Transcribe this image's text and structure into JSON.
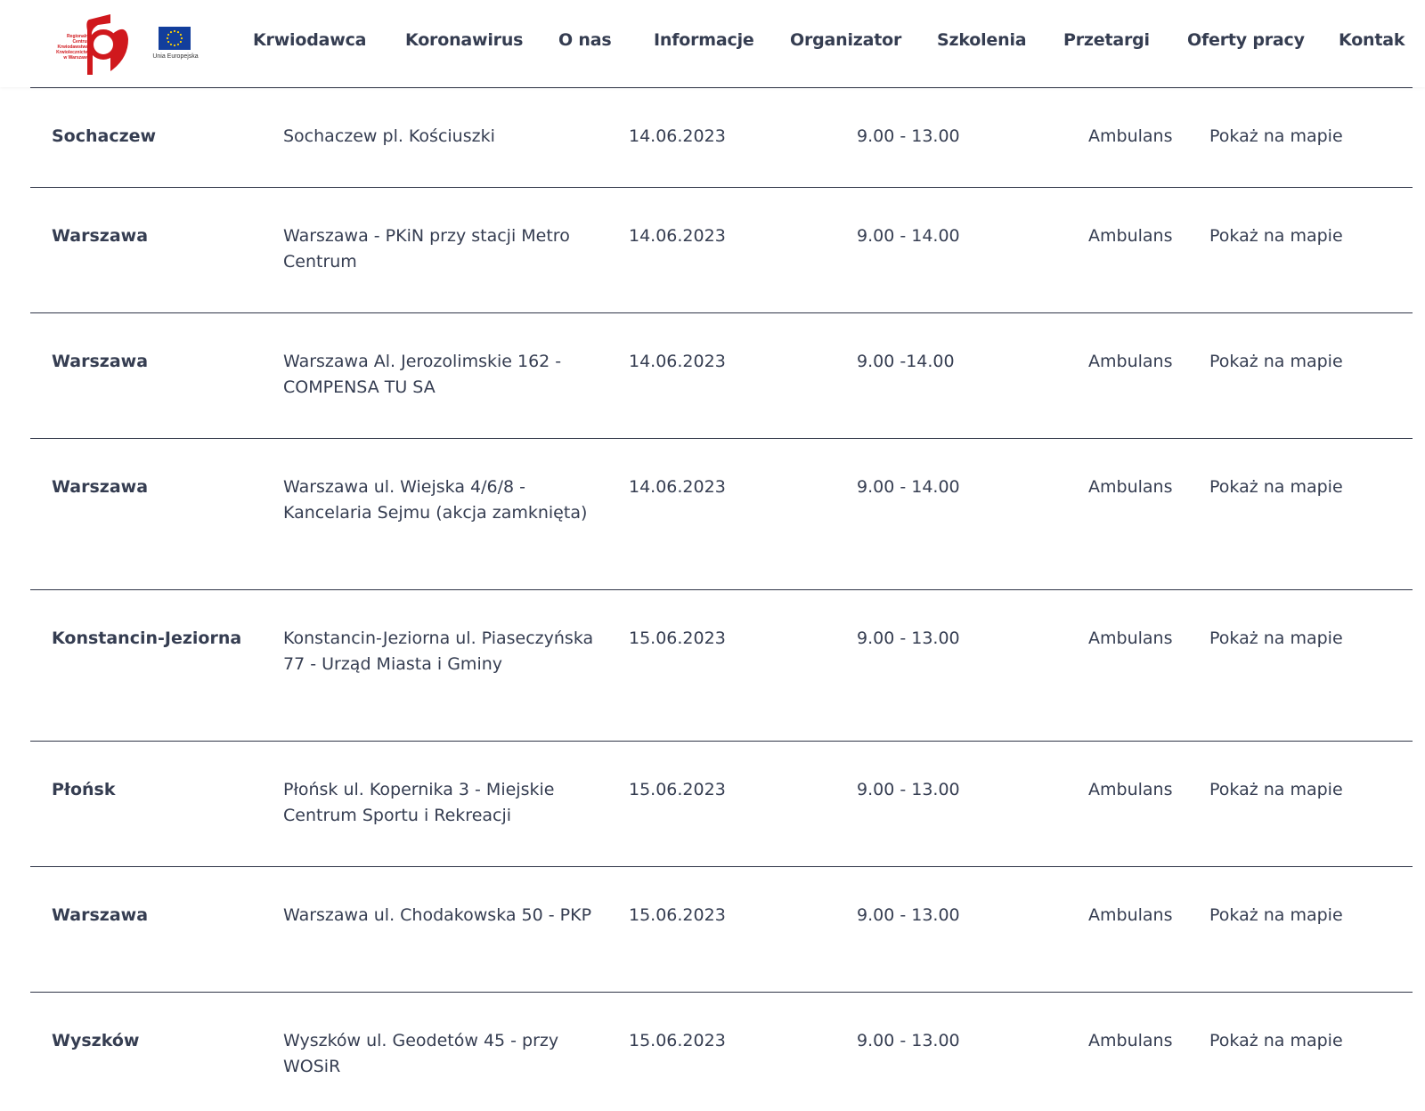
{
  "header": {
    "logo_text": "Regionalne Centrum Krwiodawstwa i Krwiolecznictwa w Warszawie",
    "eu_caption": "Unia Europejska",
    "colors": {
      "brand_red": "#d0181d",
      "eu_blue": "#123e9c",
      "eu_star": "#ffd200"
    }
  },
  "nav": {
    "items": [
      {
        "label": "Krwiodawca"
      },
      {
        "label": "Koronawirus"
      },
      {
        "label": "O nas"
      },
      {
        "label": "Informacje"
      },
      {
        "label": "Organizator"
      },
      {
        "label": "Szkolenia"
      },
      {
        "label": "Przetargi"
      },
      {
        "label": "Oferty pracy"
      },
      {
        "label": "Kontak"
      }
    ]
  },
  "rows": [
    {
      "city": "Sochaczew",
      "address": "Sochaczew pl. Kościuszki",
      "date": "14.06.2023",
      "time": "9.00 - 13.00",
      "type": "Ambulans",
      "map": "Pokaż na mapie"
    },
    {
      "city": "Warszawa",
      "address": "Warszawa - PKiN przy stacji Metro Centrum",
      "date": "14.06.2023",
      "time": "9.00 - 14.00",
      "type": "Ambulans",
      "map": "Pokaż na mapie"
    },
    {
      "city": "Warszawa",
      "address": "Warszawa Al. Jerozolimskie 162 - COMPENSA TU SA",
      "date": "14.06.2023",
      "time": "9.00 -14.00",
      "type": "Ambulans",
      "map": "Pokaż na mapie"
    },
    {
      "city": "Warszawa",
      "address": "Warszawa ul. Wiejska 4/6/8 - Kancelaria Sejmu (akcja zamknięta)",
      "date": "14.06.2023",
      "time": "9.00 - 14.00",
      "type": "Ambulans",
      "map": "Pokaż na mapie"
    },
    {
      "city": "Konstancin-Jeziorna",
      "address": "Konstancin-Jeziorna ul. Piaseczyńska 77 - Urząd Miasta i Gminy",
      "date": "15.06.2023",
      "time": "9.00 - 13.00",
      "type": "Ambulans",
      "map": "Pokaż na mapie"
    },
    {
      "city": "Płońsk",
      "address": "Płońsk ul. Kopernika 3 - Miejskie Centrum Sportu i Rekreacji",
      "date": "15.06.2023",
      "time": "9.00 - 13.00",
      "type": "Ambulans",
      "map": "Pokaż na mapie"
    },
    {
      "city": "Warszawa",
      "address": "Warszawa ul. Chodakowska 50 - PKP",
      "date": "15.06.2023",
      "time": "9.00 - 13.00",
      "type": "Ambulans",
      "map": "Pokaż na mapie"
    },
    {
      "city": "Wyszków",
      "address": "Wyszków ul. Geodetów 45 - przy WOSiR",
      "date": "15.06.2023",
      "time": "9.00 - 13.00",
      "type": "Ambulans",
      "map": "Pokaż na mapie"
    }
  ]
}
